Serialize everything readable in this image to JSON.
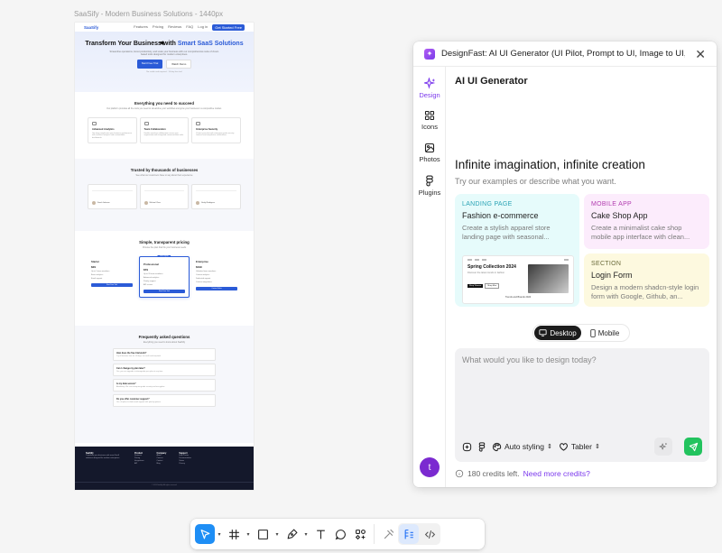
{
  "canvas": {
    "frame_title": "SaaSify - Modern Business Solutions - 1440px",
    "page": {
      "logo": "SaaSify",
      "nav_links": [
        "Features",
        "Pricing",
        "Reviews",
        "FAQ"
      ],
      "nav_login": "Log in",
      "nav_cta": "Get Started Free",
      "hero_title_a": "Transform Your Business with ",
      "hero_title_b": "Smart SaaS Solutions",
      "hero_sub": "Streamline operations, boost productivity, and scale your business with our comprehensive suite of cloud-based tools designed for modern enterprises.",
      "hero_btn_primary": "Start Free Trial",
      "hero_btn_secondary": "Watch Demo",
      "hero_note": "No credit card required · 14-day free trial",
      "features_title": "Everything you need to succeed",
      "features_sub": "Our platform provides all the tools you need to streamline your workflow and grow your business in a competitive market.",
      "features": [
        {
          "title": "Advanced Analytics",
          "desc": "Get deep insights into your business performance with real-time analytics and customizable dashboards."
        },
        {
          "title": "Team Collaboration",
          "desc": "Enable seamless collaboration across your organization with integrated communication tools."
        },
        {
          "title": "Enterprise Security",
          "desc": "Protect your data with enterprise-grade security features and compliance certifications."
        }
      ],
      "testimonials_title": "Trusted by thousands of businesses",
      "testimonials_sub": "See what our customers have to say about their experience",
      "testimonials": [
        {
          "name": "Sarah Johnson"
        },
        {
          "name": "Michael Chen"
        },
        {
          "name": "Emily Rodriguez"
        }
      ],
      "pricing_title": "Simple, transparent pricing",
      "pricing_sub": "Choose the plan that fits your business needs",
      "popular_badge": "Most Popular",
      "plans": [
        {
          "name": "Starter",
          "price": "$29",
          "features": [
            "Up to 5 team members",
            "Basic analytics",
            "Email support"
          ],
          "cta": "Start Free Trial"
        },
        {
          "name": "Professional",
          "price": "$79",
          "features": [
            "Up to 20 team members",
            "Advanced analytics",
            "Priority support",
            "API access"
          ],
          "cta": "Start Free Trial"
        },
        {
          "name": "Enterprise",
          "price": "$199",
          "features": [
            "Unlimited team members",
            "Custom analytics",
            "Dedicated support",
            "Custom integrations"
          ],
          "cta": "Contact Sales"
        }
      ],
      "faq_title": "Frequently asked questions",
      "faq_sub": "Everything you need to know about SaaSify",
      "faqs": [
        {
          "q": "How does the free trial work?",
          "a": "Try all features free for 14 days, no credit card required."
        },
        {
          "q": "Can I change my plan later?",
          "a": "Yes, you can upgrade or downgrade your plan at any time."
        },
        {
          "q": "Is my data secure?",
          "a": "Absolutely. We use enterprise-grade security and encryption."
        },
        {
          "q": "Do you offer customer support?",
          "a": "Yes, all plans include email support with priority options."
        }
      ],
      "footer": {
        "brand": "SaaSify",
        "brand_desc": "Transform your business with smart SaaS solutions designed for modern enterprises.",
        "cols": [
          {
            "head": "Product",
            "items": [
              "Features",
              "Pricing",
              "Integrations",
              "API"
            ]
          },
          {
            "head": "Company",
            "items": [
              "About",
              "Careers",
              "Contact",
              "Blog"
            ]
          },
          {
            "head": "Support",
            "items": [
              "Help Center",
              "Documentation",
              "Status",
              "Privacy"
            ]
          }
        ],
        "copyright": "© 2024 SaaSify. All rights reserved."
      }
    }
  },
  "plugin": {
    "title": "DesignFast: AI UI Generator (UI Pilot, Prompt to UI, Image to UI, M...",
    "rail": [
      {
        "label": "Design",
        "icon": "sparkle-icon",
        "active": true
      },
      {
        "label": "Icons",
        "icon": "grid-icon",
        "active": false
      },
      {
        "label": "Photos",
        "icon": "photo-icon",
        "active": false
      },
      {
        "label": "Plugins",
        "icon": "figma-icon",
        "active": false
      }
    ],
    "user_initial": "t",
    "heading": "AI UI Generator",
    "hero_title": "Infinite imagination, infinite creation",
    "hero_sub": "Try our examples or describe what you want.",
    "examples": [
      {
        "tag": "LANDING PAGE",
        "name": "Fashion e-commerce",
        "desc": "Create a stylish apparel store landing page with seasonal..."
      },
      {
        "tag": "MOBILE APP",
        "name": "Cake Shop App",
        "desc": "Create a minimalist cake shop mobile app interface with clean..."
      },
      {
        "tag": "SECTION",
        "name": "Login Form",
        "desc": "Design a modern shadcn-style login form with Google, Github, an..."
      }
    ],
    "mock_preview": {
      "title": "Spring Collection 2024",
      "text": "Discover the latest trends in fashion",
      "btn_a": "Shop Women",
      "btn_b": "Shop Men",
      "footer": "Trends and Brands 2024"
    },
    "device_toggle": {
      "desktop": "Desktop",
      "mobile": "Mobile"
    },
    "prompt_placeholder": "What would you like to design today?",
    "tools": {
      "styling": "Auto styling",
      "framework": "Tabler"
    },
    "credits_text": "180 credits left.",
    "credits_link": "Need more credits?"
  },
  "toolbar": {
    "tools": [
      "move-tool",
      "frame-tool",
      "shape-tool",
      "pen-tool",
      "text-tool",
      "comment-tool",
      "actions-tool"
    ]
  }
}
